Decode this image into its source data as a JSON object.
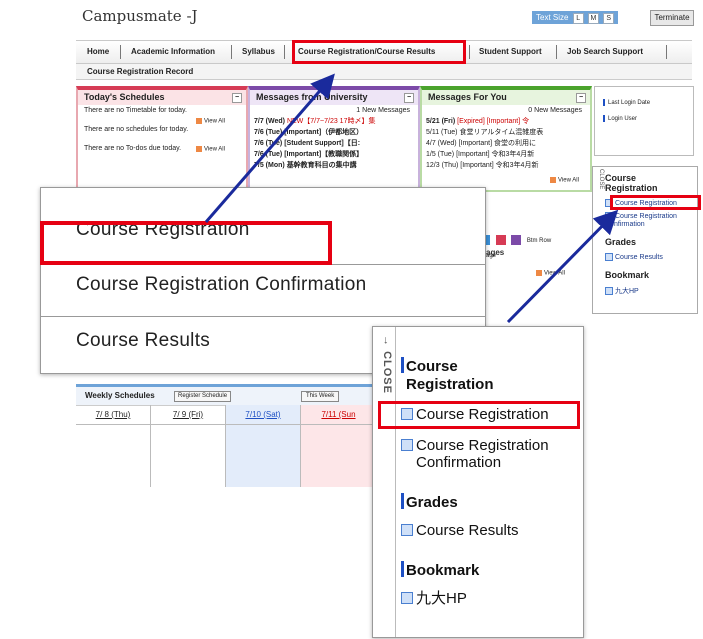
{
  "app": {
    "title": "Campusmate -J",
    "text_size_label": "Text Size",
    "text_sizes": [
      "L",
      "M",
      "S"
    ],
    "terminate_label": "Terminate"
  },
  "nav": {
    "items": [
      "Home",
      "Academic Information",
      "Syllabus",
      "Course Registration/Course Results",
      "Student Support",
      "Job Search Support"
    ],
    "sub_item": "Course Registration Record"
  },
  "panels": {
    "schedules": {
      "title": "Today's Schedules",
      "lines": [
        "There are no Timetable for today.",
        "There are no schedules for today.",
        "There are no To-dos due today."
      ],
      "view_all": "View All"
    },
    "university": {
      "title": "Messages from University",
      "new_count": "1 New Messages",
      "rows": [
        {
          "date": "7/7 (Wed)",
          "text": "NEW【7/7~7/23 17時〆】集"
        },
        {
          "date": "7/6 (Tue)",
          "text": "[Important]（伊都地区）"
        },
        {
          "date": "7/6 (Tue)",
          "text": "[Student Support]【日:"
        },
        {
          "date": "7/6 (Tue)",
          "text": "[Important]【教職関係】"
        },
        {
          "date": "7/5 (Mon)",
          "text": "基幹教育科目の集中講"
        }
      ]
    },
    "for_you": {
      "title": "Messages For You",
      "new_count": "0 New Messages",
      "rows": [
        {
          "date": "5/21 (Fri)",
          "text": "[Expired] [Important] 令"
        },
        {
          "date": "5/11 (Tue)",
          "text": "食堂リアルタイム混雑度表"
        },
        {
          "date": "4/7 (Wed)",
          "text": "[Important] 食堂の利用に"
        },
        {
          "date": "1/5 (Tue)",
          "text": "[Important] 令和3年4月新"
        },
        {
          "date": "12/3 (Thu)",
          "text": "[Important] 令和3年4月新"
        }
      ],
      "view_all": "View All"
    }
  },
  "login": {
    "last_login": "Last Login Date",
    "login_user": "Login User"
  },
  "sidebar_small": {
    "close": "CLOSE",
    "heading_registration": "Course Registration",
    "items_registration": [
      "Course Registration",
      "Course Registration Confirmation"
    ],
    "heading_grades": "Grades",
    "items_grades": [
      "Course Results"
    ],
    "heading_bookmark": "Bookmark",
    "items_bookmark": [
      "九大HP"
    ]
  },
  "fragments": {
    "ages": "ages",
    "btm_row": "Btm Row",
    "age": "age",
    "view_all": "View All"
  },
  "weekly": {
    "title": "Weekly Schedules",
    "register_label": "Register Schedule",
    "this_week": "This Week",
    "days": [
      "7/ 8 (Thu)",
      "7/ 9 (Fri)",
      "7/10 (Sat)",
      "7/11 (Sun"
    ]
  },
  "zoom_menu": {
    "items": [
      "Course Registration",
      "Course Registration Confirmation",
      "Course Results"
    ]
  },
  "zoom_side": {
    "close": "CLOSE",
    "heading_registration_1": "Course",
    "heading_registration_2": "Registration",
    "item_registration": "Course Registration",
    "item_confirmation_1": "Course Registration",
    "item_confirmation_2": "Confirmation",
    "heading_grades": "Grades",
    "item_results": "Course Results",
    "heading_bookmark": "Bookmark",
    "item_bookmark": "九大HP"
  },
  "colors": {
    "highlight": "#e60012",
    "arrow": "#1a2a9c",
    "accent_blue": "#1e50c4"
  }
}
